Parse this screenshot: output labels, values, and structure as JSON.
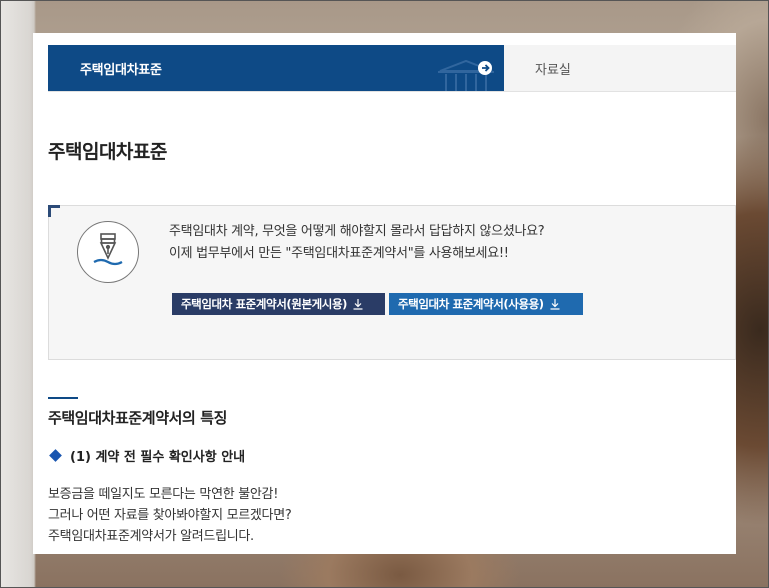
{
  "tabs": {
    "active_label": "주택임대차표준",
    "other_label": "자료실"
  },
  "page_title": "주택임대차표준",
  "notice": {
    "line1": "주택임대차 계약, 무엇을 어떻게 해야할지 몰라서 답답하지 않으셨나요?",
    "line2": "이제 법무부에서 만든 \"주택임대차표준계약서\"를 사용해보세요!!",
    "button_original": "주택임대차 표준계약서(원본게시용)",
    "button_usage": "주택임대차 표준계약서(사용용)"
  },
  "section": {
    "title": "주택임대차표준계약서의 특징",
    "subheading": "(1) 계약 전 필수 확인사항 안내",
    "lines": [
      "보증금을 떼일지도 모른다는 막연한 불안감!",
      "그러나 어떤 자료를 찾아봐야할지 모르겠다면?",
      "주택임대차표준계약서가 알려드립니다."
    ]
  },
  "icons": {
    "pen": "fountain-pen-icon",
    "download": "download-icon",
    "arrow": "arrow-right-circle-icon",
    "building": "government-building-icon"
  },
  "colors": {
    "primary": "#0e4a86",
    "button_dark": "#2a3c66",
    "button_blue": "#1f6aaf",
    "bullet": "#1a56b0"
  }
}
